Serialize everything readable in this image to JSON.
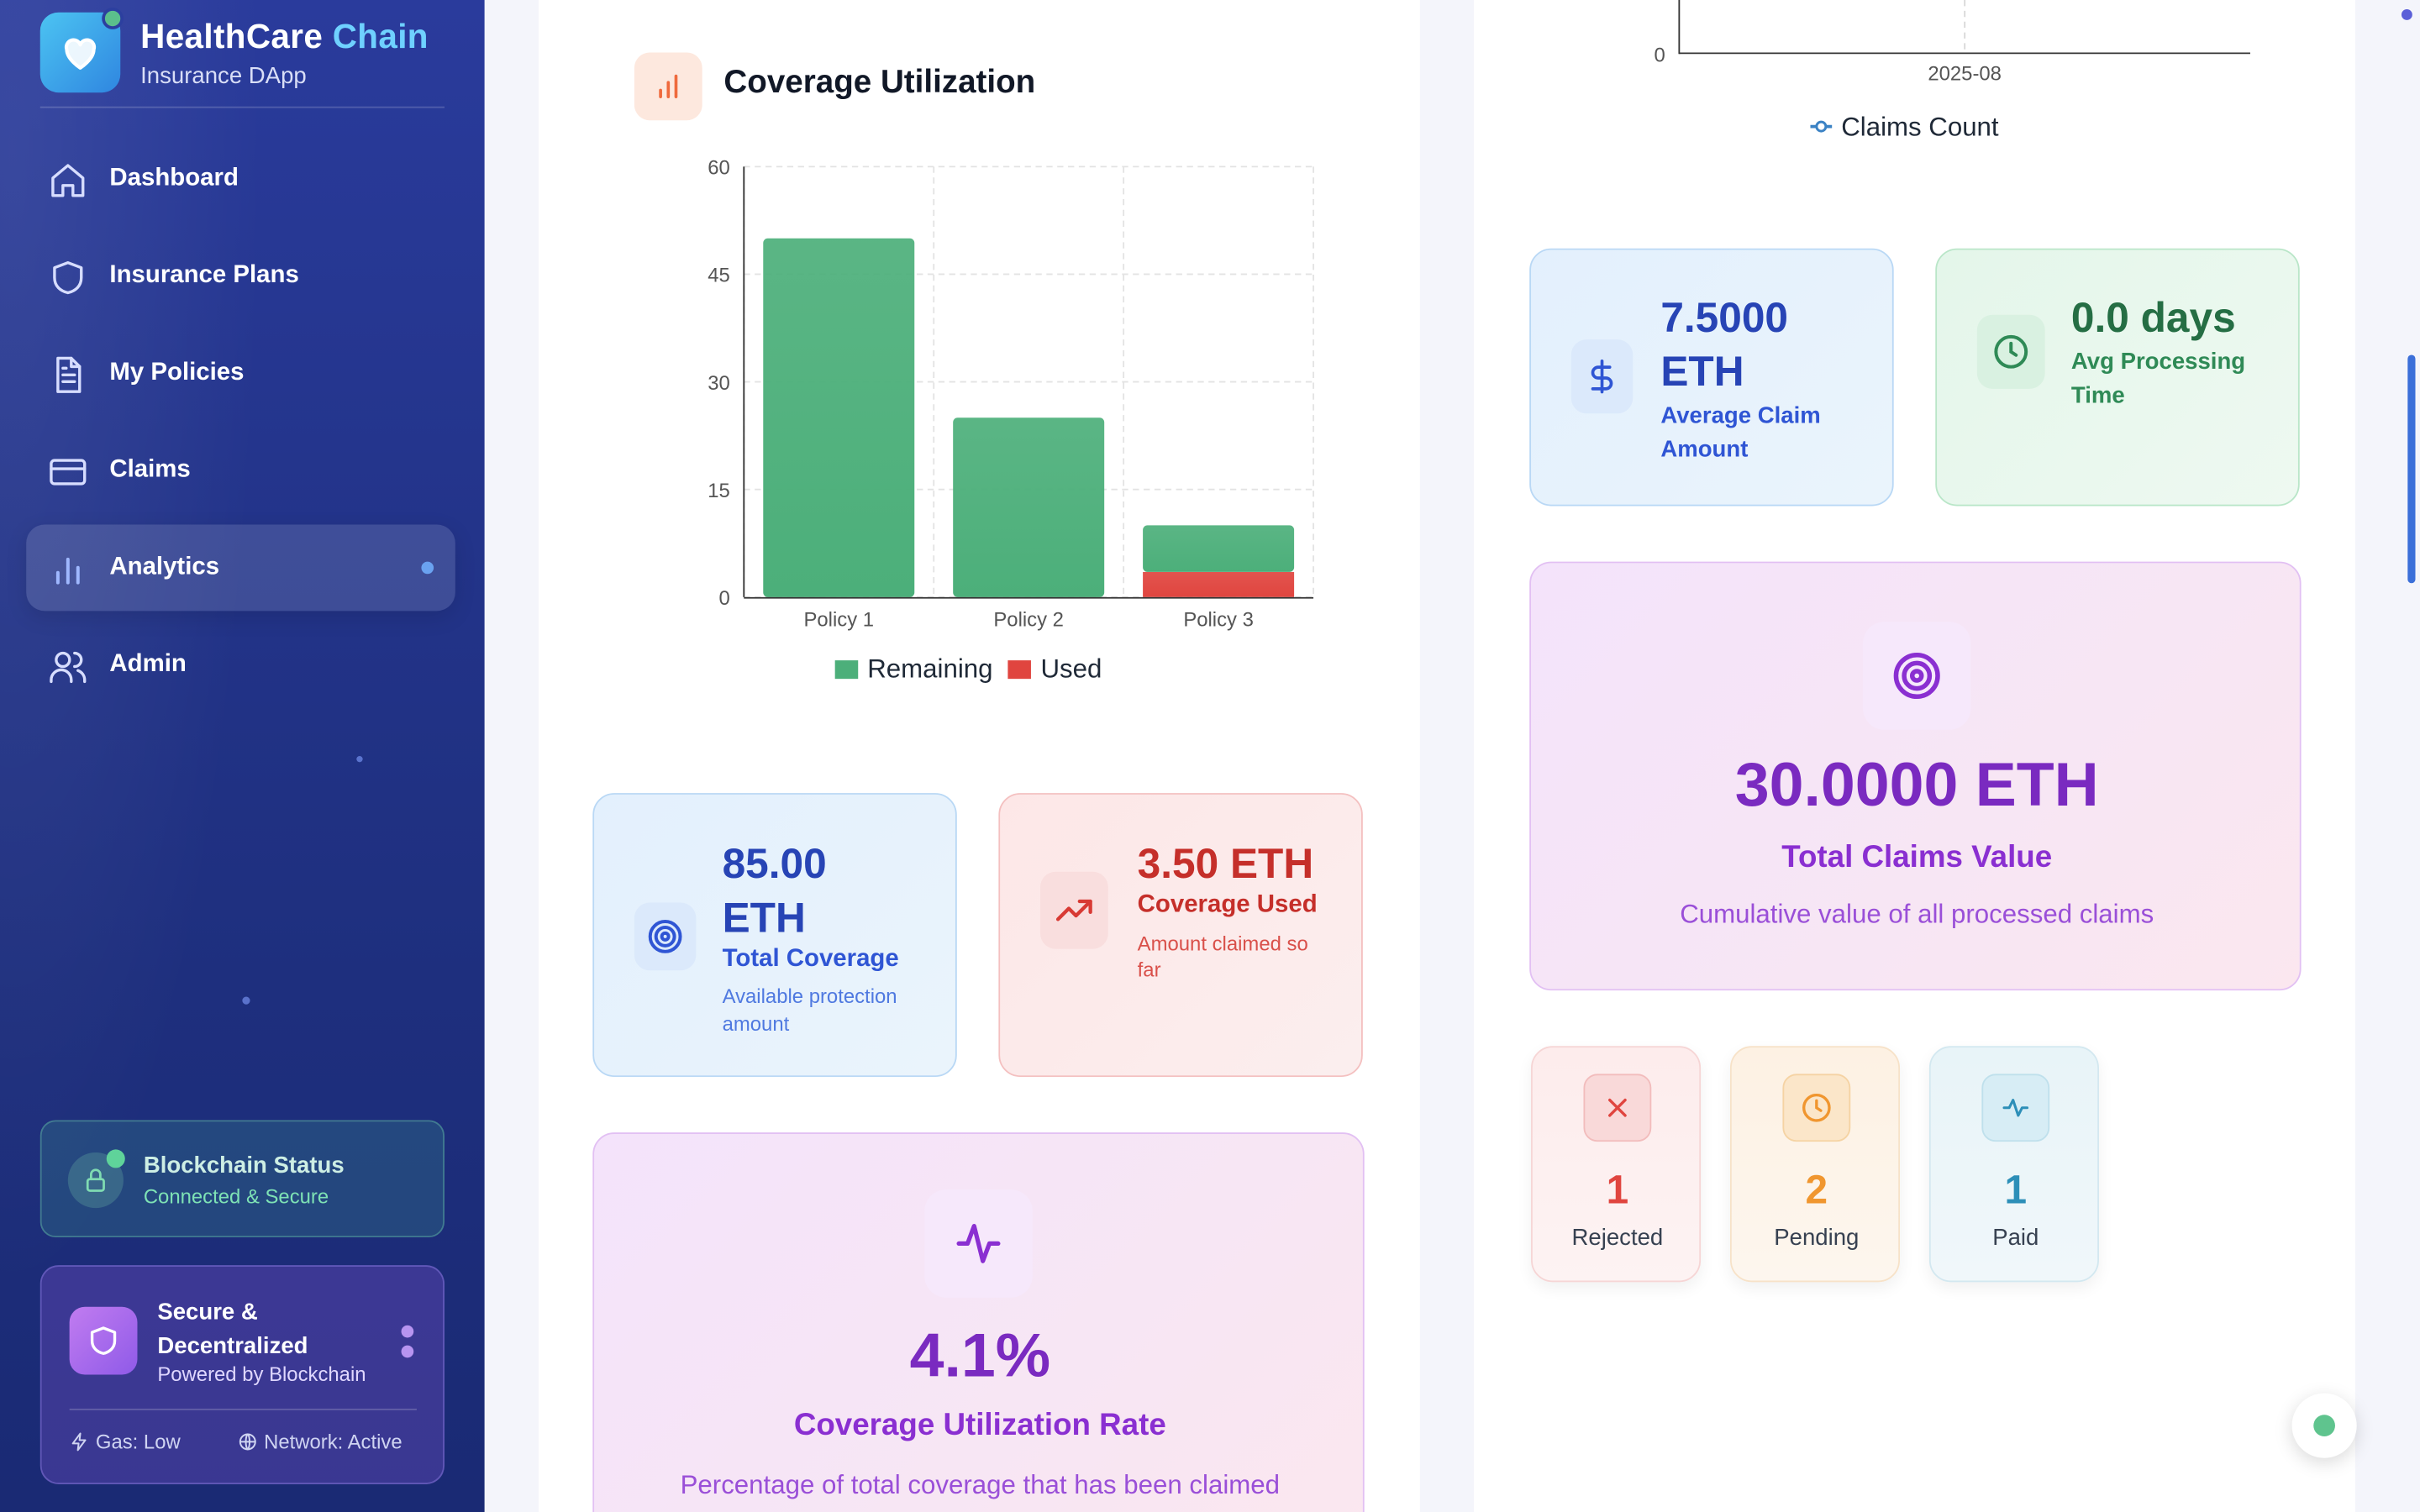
{
  "sidebar": {
    "brand": {
      "name": "HealthCare",
      "accent": "Chain",
      "subtitle": "Insurance DApp"
    },
    "nav": [
      {
        "label": "Dashboard",
        "icon": "home-icon"
      },
      {
        "label": "Insurance Plans",
        "icon": "shield-icon"
      },
      {
        "label": "My Policies",
        "icon": "document-icon"
      },
      {
        "label": "Claims",
        "icon": "credit-card-icon"
      },
      {
        "label": "Analytics",
        "icon": "bar-chart-icon",
        "active": true
      },
      {
        "label": "Admin",
        "icon": "users-icon"
      }
    ],
    "status": {
      "title": "Blockchain Status",
      "subtitle": "Connected & Secure"
    },
    "secure": {
      "title": "Secure & Decentralized",
      "subtitle": "Powered by Blockchain",
      "gas": "Gas: Low",
      "network": "Network: Active"
    }
  },
  "coverage_chart": {
    "title": "Coverage Utilization",
    "legend": [
      "Remaining",
      "Used"
    ]
  },
  "chart_data": [
    {
      "type": "bar",
      "stacked": true,
      "title": "Coverage Utilization",
      "categories": [
        "Policy 1",
        "Policy 2",
        "Policy 3"
      ],
      "series": [
        {
          "name": "Remaining",
          "values": [
            50,
            25,
            6.5
          ],
          "color": "#4caf7a"
        },
        {
          "name": "Used",
          "values": [
            0,
            0,
            3.5
          ],
          "color": "#e0453f"
        }
      ],
      "ylim": [
        0,
        60
      ],
      "yticks": [
        0,
        15,
        30,
        45,
        60
      ],
      "grid": true,
      "legend": "bottom"
    },
    {
      "type": "line",
      "partial": true,
      "categories": [
        "2025-08"
      ],
      "yticks": [
        0
      ],
      "series": [
        {
          "name": "Claims Count"
        }
      ],
      "legend": "bottom"
    }
  ],
  "claims_chart": {
    "y_tick": "0",
    "x_tick": "2025-08",
    "legend": "Claims Count"
  },
  "total_coverage": {
    "value": "85.00 ETH",
    "value_line1": "85.00",
    "value_line2": "ETH",
    "label": "Total Coverage",
    "desc": "Available protection amount"
  },
  "coverage_used": {
    "value": "3.50 ETH",
    "label": "Coverage Used",
    "desc": "Amount claimed so far"
  },
  "utilization": {
    "value": "4.1%",
    "label": "Coverage Utilization Rate",
    "desc": "Percentage of total coverage that has been claimed"
  },
  "avg_claim": {
    "value_line1": "7.5000",
    "value_line2": "ETH",
    "label": "Average Claim Amount"
  },
  "avg_processing": {
    "value": "0.0 days",
    "label": "Avg Processing Time"
  },
  "total_claims": {
    "value": "30.0000 ETH",
    "label": "Total Claims Value",
    "desc": "Cumulative value of all processed claims"
  },
  "status_counts": [
    {
      "label": "Rejected",
      "count": "1",
      "icon": "x-icon",
      "color": "#e0453f"
    },
    {
      "label": "Pending",
      "count": "2",
      "icon": "clock-icon",
      "color": "#f0962f"
    },
    {
      "label": "Paid",
      "count": "1",
      "icon": "activity-icon",
      "color": "#2d8fb8"
    }
  ],
  "colors": {
    "sidebar": "#23348a",
    "accent": "#6fd1ff",
    "remaining": "#4caf7a",
    "used": "#e0453f",
    "purple": "#8a2fd1"
  }
}
